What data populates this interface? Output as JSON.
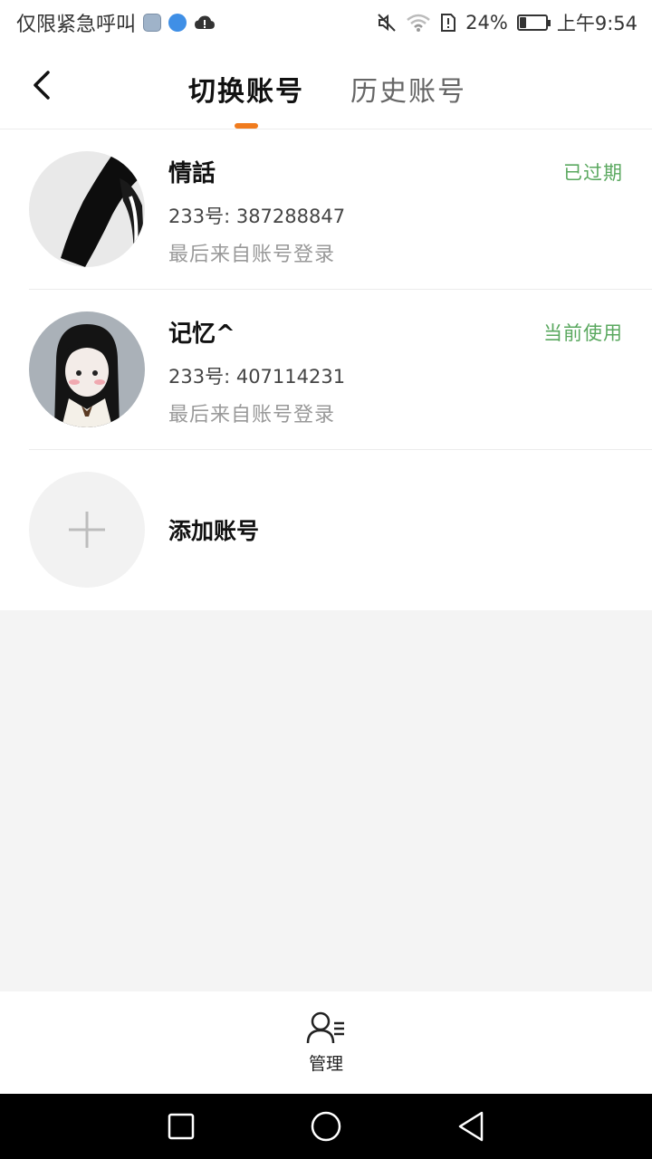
{
  "status_bar": {
    "left_text": "仅限紧急呼叫",
    "battery_percent": "24%",
    "battery_level": 0.24,
    "time": "上午9:54",
    "icons": [
      "sim-app-icon",
      "browser-icon",
      "cloud-icon",
      "mute-icon",
      "wifi-icon",
      "sim-alert-icon",
      "battery-icon"
    ]
  },
  "header": {
    "tab_active": "切换账号",
    "tab_inactive": "历史账号",
    "accent": "#f07b1e"
  },
  "accounts": [
    {
      "name": "情話",
      "uid": "233号: 387288847",
      "last_login": "最后来自账号登录",
      "status": "已过期"
    },
    {
      "name": "记忆^",
      "uid": "233号: 407114231",
      "last_login": "最后来自账号登录",
      "status": "当前使用"
    }
  ],
  "add_account": {
    "label": "添加账号"
  },
  "manage": {
    "label": "管理"
  },
  "colors": {
    "status_green": "#5aa85f",
    "page_bg": "#f4f4f4"
  }
}
